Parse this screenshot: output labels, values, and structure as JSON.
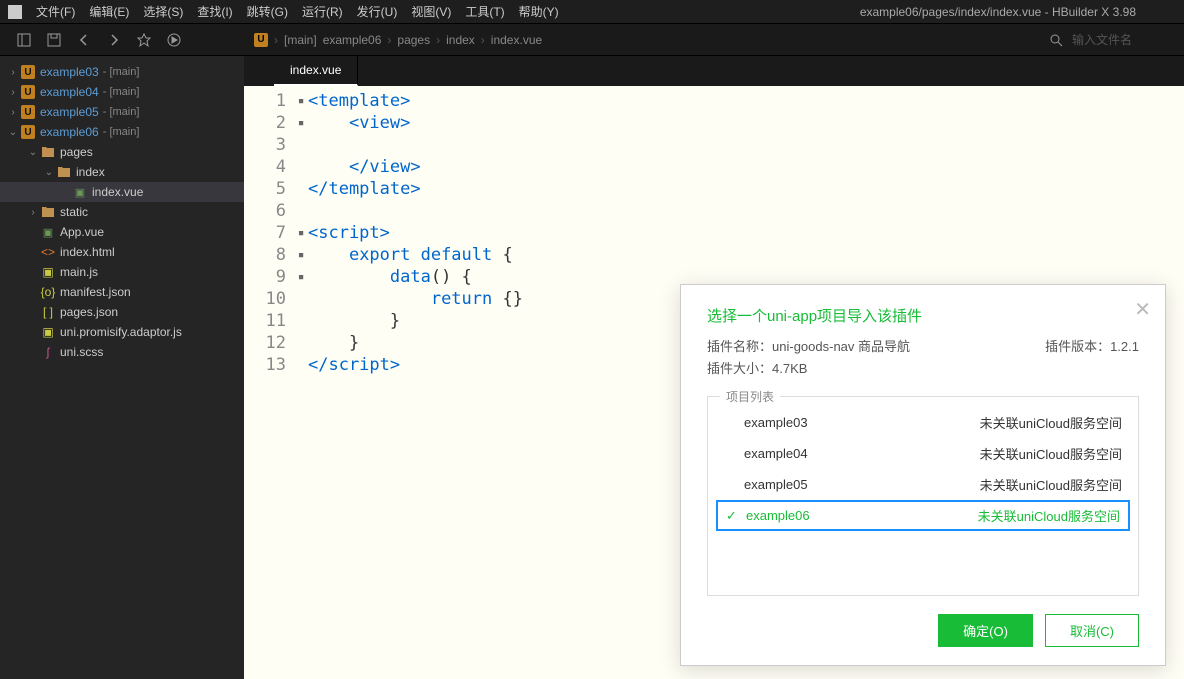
{
  "window": {
    "title": "example06/pages/index/index.vue - HBuilder X 3.98"
  },
  "menubar": {
    "items": [
      "文件(F)",
      "编辑(E)",
      "选择(S)",
      "查找(I)",
      "跳转(G)",
      "运行(R)",
      "发行(U)",
      "视图(V)",
      "工具(T)",
      "帮助(Y)"
    ]
  },
  "toolbar": {
    "search_placeholder": "输入文件名"
  },
  "breadcrumb": {
    "items": [
      "[main]",
      "example06",
      "pages",
      "index",
      "index.vue"
    ]
  },
  "sidebar": {
    "projects": [
      {
        "name": "example03",
        "branch": "- [main]",
        "expanded": false
      },
      {
        "name": "example04",
        "branch": "- [main]",
        "expanded": false
      },
      {
        "name": "example05",
        "branch": "- [main]",
        "expanded": false
      },
      {
        "name": "example06",
        "branch": "- [main]",
        "expanded": true
      }
    ],
    "folders": {
      "pages": "pages",
      "index": "index",
      "static": "static"
    },
    "files": {
      "index_vue": "index.vue",
      "app_vue": "App.vue",
      "index_html": "index.html",
      "main_js": "main.js",
      "manifest_json": "manifest.json",
      "pages_json": "pages.json",
      "uni_promisify": "uni.promisify.adaptor.js",
      "uni_scss": "uni.scss"
    }
  },
  "tabs": {
    "active": "index.vue"
  },
  "code": {
    "lines": [
      {
        "n": 1,
        "fold": "▪",
        "html": "<span class='tk-tag'>&lt;template&gt;</span>"
      },
      {
        "n": 2,
        "fold": "▪",
        "html": "    <span class='tk-tag'>&lt;view&gt;</span>"
      },
      {
        "n": 3,
        "fold": "",
        "html": ""
      },
      {
        "n": 4,
        "fold": "",
        "html": "    <span class='tk-tag'>&lt;/view&gt;</span>"
      },
      {
        "n": 5,
        "fold": "",
        "html": "<span class='tk-tag'>&lt;/template&gt;</span>"
      },
      {
        "n": 6,
        "fold": "",
        "html": ""
      },
      {
        "n": 7,
        "fold": "▪",
        "html": "<span class='tk-tag'>&lt;script&gt;</span>"
      },
      {
        "n": 8,
        "fold": "▪",
        "html": "    <span class='tk-kw'>export default</span> <span class='tk-pn'>{</span>"
      },
      {
        "n": 9,
        "fold": "▪",
        "html": "        <span class='tk-fn'>data</span><span class='tk-pn'>() {</span>"
      },
      {
        "n": 10,
        "fold": "",
        "html": "            <span class='tk-kw'>return</span> <span class='tk-pn'>{}</span>"
      },
      {
        "n": 11,
        "fold": "",
        "html": "        <span class='tk-pn'>}</span>"
      },
      {
        "n": 12,
        "fold": "",
        "html": "    <span class='tk-pn'>}</span>"
      },
      {
        "n": 13,
        "fold": "",
        "html": "<span class='tk-tag'>&lt;/script&gt;</span>"
      }
    ]
  },
  "dialog": {
    "title": "选择一个uni-app项目导入该插件",
    "plugin_name_label": "插件名称：",
    "plugin_name": "uni-goods-nav 商品导航",
    "plugin_version_label": "插件版本：",
    "plugin_version": "1.2.1",
    "plugin_size_label": "插件大小：",
    "plugin_size": "4.7KB",
    "list_legend": "项目列表",
    "projects": [
      {
        "name": "example03",
        "status": "未关联uniCloud服务空间",
        "selected": false
      },
      {
        "name": "example04",
        "status": "未关联uniCloud服务空间",
        "selected": false
      },
      {
        "name": "example05",
        "status": "未关联uniCloud服务空间",
        "selected": false
      },
      {
        "name": "example06",
        "status": "未关联uniCloud服务空间",
        "selected": true
      }
    ],
    "ok": "确定(O)",
    "cancel": "取消(C)"
  }
}
